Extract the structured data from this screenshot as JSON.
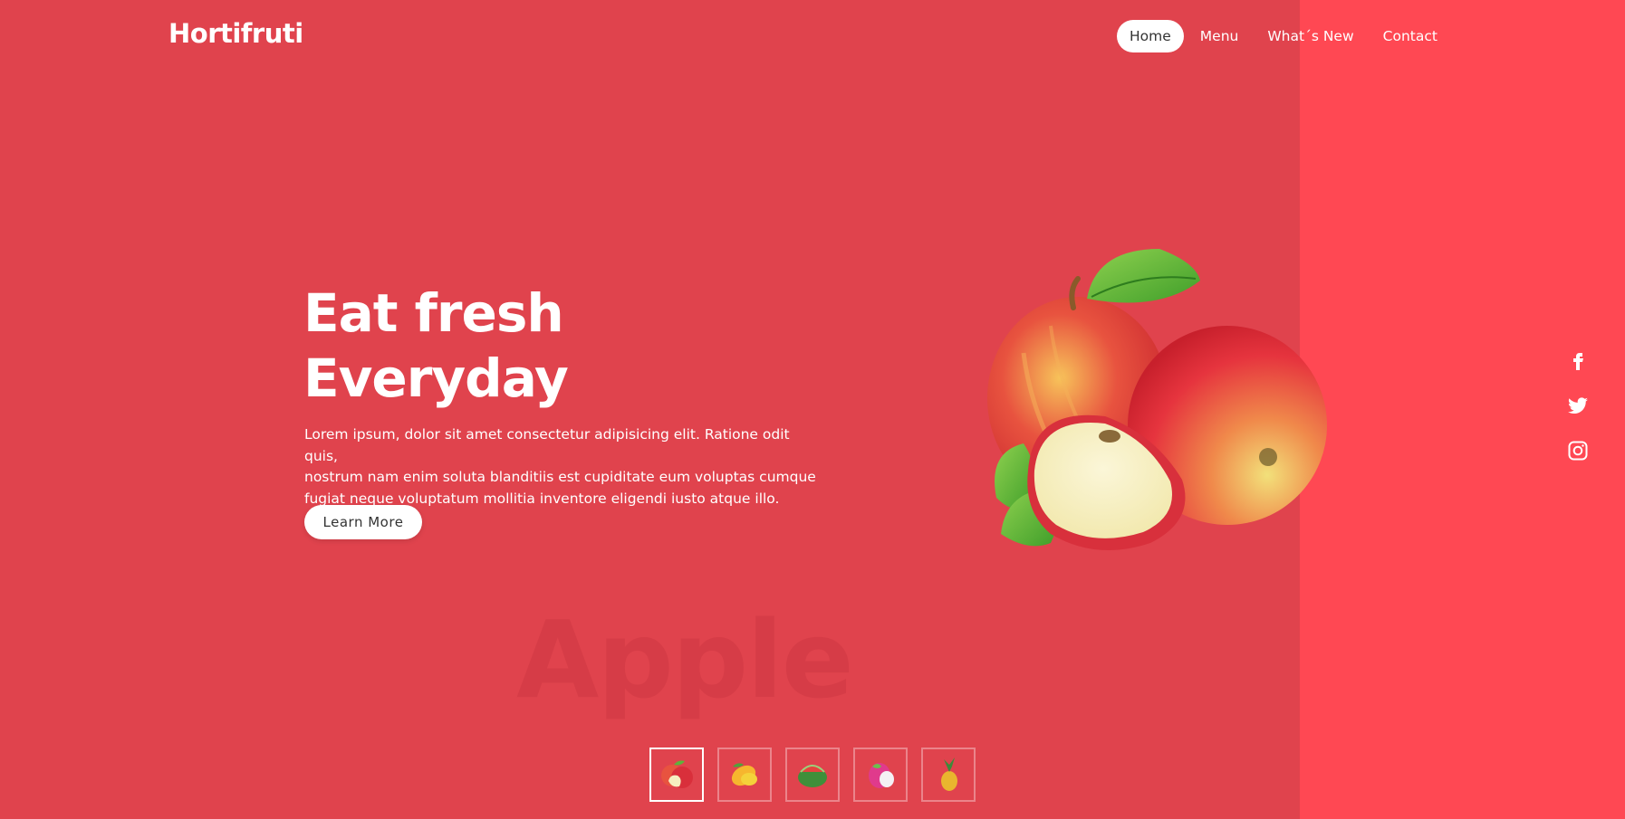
{
  "brand": {
    "name": "Hortifruti"
  },
  "nav": {
    "items": [
      {
        "label": "Home",
        "active": true
      },
      {
        "label": "Menu"
      },
      {
        "label": "What´s New"
      },
      {
        "label": "Contact"
      }
    ]
  },
  "hero": {
    "title_line1": "Eat fresh",
    "title_line2": "Everyday",
    "text_line1": "Lorem ipsum, dolor sit amet consectetur adipisicing elit. Ratione odit quis,",
    "text_line2": "nostrum nam enim soluta blanditiis est cupiditate eum voluptas cumque",
    "text_line3": "fugiat neque voluptatum mollitia inventore eligendi iusto atque illo.",
    "button_label": "Learn More",
    "watermark": "Apple",
    "image": "apples-image"
  },
  "social": [
    "facebook-icon",
    "twitter-icon",
    "instagram-icon"
  ],
  "thumbnails": [
    {
      "fruit": "apple",
      "active": true
    },
    {
      "fruit": "mango"
    },
    {
      "fruit": "watermelon"
    },
    {
      "fruit": "dragon-fruit"
    },
    {
      "fruit": "pineapple"
    }
  ],
  "colors": {
    "panel": "#E0434D",
    "accent_strip": "#FF4853",
    "text": "#FFFFFF",
    "button_bg": "#FFFFFF",
    "button_text": "#333333"
  }
}
